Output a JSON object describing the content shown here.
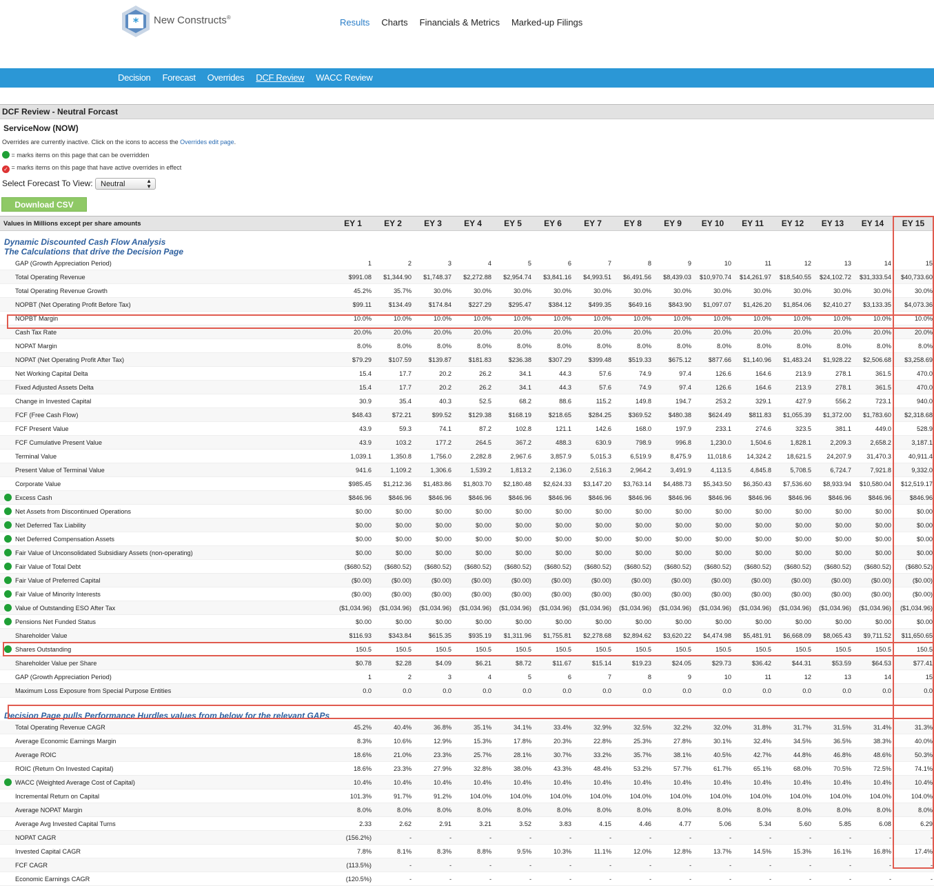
{
  "brand": {
    "name": "New Constructs",
    "reg": "®"
  },
  "top_nav": [
    "Results",
    "Charts",
    "Financials & Metrics",
    "Marked-up Filings"
  ],
  "sub_nav": [
    "Decision",
    "Forecast",
    "Overrides",
    "DCF Review",
    "WACC Review"
  ],
  "section_title": "DCF Review - Neutral Forcast",
  "company": "ServiceNow (NOW)",
  "notes": {
    "inactive_pre": "Overrides are currently inactive. Click on the icons to access the ",
    "inactive_link": "Overrides edit page",
    "inactive_post": ".",
    "green": " = marks items on this page that can be overridden",
    "red": " = marks items on this page that have active overrides in effect"
  },
  "forecast": {
    "label": "Select Forecast To View:",
    "value": "Neutral"
  },
  "download_label": "Download CSV",
  "table": {
    "header_label": "Values in Millions except per share amounts",
    "columns": [
      "EY 1",
      "EY 2",
      "EY 3",
      "EY 4",
      "EY 5",
      "EY 6",
      "EY 7",
      "EY 8",
      "EY 9",
      "EY 10",
      "EY 11",
      "EY 12",
      "EY 13",
      "EY 14",
      "EY 15"
    ],
    "section1": [
      "Dynamic Discounted Cash Flow Analysis",
      "The Calculations that drive the Decision Page"
    ],
    "rows1": [
      {
        "label": "GAP (Growth Appreciation Period)",
        "o": false,
        "v": [
          "1",
          "2",
          "3",
          "4",
          "5",
          "6",
          "7",
          "8",
          "9",
          "10",
          "11",
          "12",
          "13",
          "14",
          "15"
        ]
      },
      {
        "label": "Total Operating Revenue",
        "o": false,
        "v": [
          "$991.08",
          "$1,344.90",
          "$1,748.37",
          "$2,272.88",
          "$2,954.74",
          "$3,841.16",
          "$4,993.51",
          "$6,491.56",
          "$8,439.03",
          "$10,970.74",
          "$14,261.97",
          "$18,540.55",
          "$24,102.72",
          "$31,333.54",
          "$40,733.60"
        ]
      },
      {
        "label": "Total Operating Revenue Growth",
        "o": false,
        "v": [
          "45.2%",
          "35.7%",
          "30.0%",
          "30.0%",
          "30.0%",
          "30.0%",
          "30.0%",
          "30.0%",
          "30.0%",
          "30.0%",
          "30.0%",
          "30.0%",
          "30.0%",
          "30.0%",
          "30.0%"
        ]
      },
      {
        "label": "NOPBT (Net Operating Profit Before Tax)",
        "o": false,
        "v": [
          "$99.11",
          "$134.49",
          "$174.84",
          "$227.29",
          "$295.47",
          "$384.12",
          "$499.35",
          "$649.16",
          "$843.90",
          "$1,097.07",
          "$1,426.20",
          "$1,854.06",
          "$2,410.27",
          "$3,133.35",
          "$4,073.36"
        ]
      },
      {
        "label": "NOPBT Margin",
        "o": false,
        "v": [
          "10.0%",
          "10.0%",
          "10.0%",
          "10.0%",
          "10.0%",
          "10.0%",
          "10.0%",
          "10.0%",
          "10.0%",
          "10.0%",
          "10.0%",
          "10.0%",
          "10.0%",
          "10.0%",
          "10.0%"
        ]
      },
      {
        "label": "Cash Tax Rate",
        "o": false,
        "v": [
          "20.0%",
          "20.0%",
          "20.0%",
          "20.0%",
          "20.0%",
          "20.0%",
          "20.0%",
          "20.0%",
          "20.0%",
          "20.0%",
          "20.0%",
          "20.0%",
          "20.0%",
          "20.0%",
          "20.0%"
        ]
      },
      {
        "label": "NOPAT Margin",
        "o": false,
        "v": [
          "8.0%",
          "8.0%",
          "8.0%",
          "8.0%",
          "8.0%",
          "8.0%",
          "8.0%",
          "8.0%",
          "8.0%",
          "8.0%",
          "8.0%",
          "8.0%",
          "8.0%",
          "8.0%",
          "8.0%"
        ]
      },
      {
        "label": "NOPAT (Net Operating Profit After Tax)",
        "o": false,
        "v": [
          "$79.29",
          "$107.59",
          "$139.87",
          "$181.83",
          "$236.38",
          "$307.29",
          "$399.48",
          "$519.33",
          "$675.12",
          "$877.66",
          "$1,140.96",
          "$1,483.24",
          "$1,928.22",
          "$2,506.68",
          "$3,258.69"
        ]
      },
      {
        "label": "Net Working Capital Delta",
        "o": false,
        "v": [
          "15.4",
          "17.7",
          "20.2",
          "26.2",
          "34.1",
          "44.3",
          "57.6",
          "74.9",
          "97.4",
          "126.6",
          "164.6",
          "213.9",
          "278.1",
          "361.5",
          "470.0"
        ]
      },
      {
        "label": "Fixed Adjusted Assets Delta",
        "o": false,
        "v": [
          "15.4",
          "17.7",
          "20.2",
          "26.2",
          "34.1",
          "44.3",
          "57.6",
          "74.9",
          "97.4",
          "126.6",
          "164.6",
          "213.9",
          "278.1",
          "361.5",
          "470.0"
        ]
      },
      {
        "label": "Change in Invested Capital",
        "o": false,
        "v": [
          "30.9",
          "35.4",
          "40.3",
          "52.5",
          "68.2",
          "88.6",
          "115.2",
          "149.8",
          "194.7",
          "253.2",
          "329.1",
          "427.9",
          "556.2",
          "723.1",
          "940.0"
        ]
      },
      {
        "label": "FCF (Free Cash Flow)",
        "o": false,
        "v": [
          "$48.43",
          "$72.21",
          "$99.52",
          "$129.38",
          "$168.19",
          "$218.65",
          "$284.25",
          "$369.52",
          "$480.38",
          "$624.49",
          "$811.83",
          "$1,055.39",
          "$1,372.00",
          "$1,783.60",
          "$2,318.68"
        ]
      },
      {
        "label": "FCF Present Value",
        "o": false,
        "v": [
          "43.9",
          "59.3",
          "74.1",
          "87.2",
          "102.8",
          "121.1",
          "142.6",
          "168.0",
          "197.9",
          "233.1",
          "274.6",
          "323.5",
          "381.1",
          "449.0",
          "528.9"
        ]
      },
      {
        "label": "FCF Cumulative Present Value",
        "o": false,
        "v": [
          "43.9",
          "103.2",
          "177.2",
          "264.5",
          "367.2",
          "488.3",
          "630.9",
          "798.9",
          "996.8",
          "1,230.0",
          "1,504.6",
          "1,828.1",
          "2,209.3",
          "2,658.2",
          "3,187.1"
        ]
      },
      {
        "label": "Terminal Value",
        "o": false,
        "v": [
          "1,039.1",
          "1,350.8",
          "1,756.0",
          "2,282.8",
          "2,967.6",
          "3,857.9",
          "5,015.3",
          "6,519.9",
          "8,475.9",
          "11,018.6",
          "14,324.2",
          "18,621.5",
          "24,207.9",
          "31,470.3",
          "40,911.4"
        ]
      },
      {
        "label": "Present Value of Terminal Value",
        "o": false,
        "v": [
          "941.6",
          "1,109.2",
          "1,306.6",
          "1,539.2",
          "1,813.2",
          "2,136.0",
          "2,516.3",
          "2,964.2",
          "3,491.9",
          "4,113.5",
          "4,845.8",
          "5,708.5",
          "6,724.7",
          "7,921.8",
          "9,332.0"
        ]
      },
      {
        "label": "Corporate Value",
        "o": false,
        "v": [
          "$985.45",
          "$1,212.36",
          "$1,483.86",
          "$1,803.70",
          "$2,180.48",
          "$2,624.33",
          "$3,147.20",
          "$3,763.14",
          "$4,488.73",
          "$5,343.50",
          "$6,350.43",
          "$7,536.60",
          "$8,933.94",
          "$10,580.04",
          "$12,519.17"
        ]
      },
      {
        "label": "Excess Cash",
        "o": true,
        "v": [
          "$846.96",
          "$846.96",
          "$846.96",
          "$846.96",
          "$846.96",
          "$846.96",
          "$846.96",
          "$846.96",
          "$846.96",
          "$846.96",
          "$846.96",
          "$846.96",
          "$846.96",
          "$846.96",
          "$846.96"
        ]
      },
      {
        "label": "Net Assets from Discontinued Operations",
        "o": true,
        "v": [
          "$0.00",
          "$0.00",
          "$0.00",
          "$0.00",
          "$0.00",
          "$0.00",
          "$0.00",
          "$0.00",
          "$0.00",
          "$0.00",
          "$0.00",
          "$0.00",
          "$0.00",
          "$0.00",
          "$0.00"
        ]
      },
      {
        "label": "Net Deferred Tax Liability",
        "o": true,
        "v": [
          "$0.00",
          "$0.00",
          "$0.00",
          "$0.00",
          "$0.00",
          "$0.00",
          "$0.00",
          "$0.00",
          "$0.00",
          "$0.00",
          "$0.00",
          "$0.00",
          "$0.00",
          "$0.00",
          "$0.00"
        ]
      },
      {
        "label": "Net Deferred Compensation Assets",
        "o": true,
        "v": [
          "$0.00",
          "$0.00",
          "$0.00",
          "$0.00",
          "$0.00",
          "$0.00",
          "$0.00",
          "$0.00",
          "$0.00",
          "$0.00",
          "$0.00",
          "$0.00",
          "$0.00",
          "$0.00",
          "$0.00"
        ]
      },
      {
        "label": "Fair Value of Unconsolidated Subsidiary Assets (non-operating)",
        "o": true,
        "v": [
          "$0.00",
          "$0.00",
          "$0.00",
          "$0.00",
          "$0.00",
          "$0.00",
          "$0.00",
          "$0.00",
          "$0.00",
          "$0.00",
          "$0.00",
          "$0.00",
          "$0.00",
          "$0.00",
          "$0.00"
        ]
      },
      {
        "label": "Fair Value of Total Debt",
        "o": true,
        "v": [
          "($680.52)",
          "($680.52)",
          "($680.52)",
          "($680.52)",
          "($680.52)",
          "($680.52)",
          "($680.52)",
          "($680.52)",
          "($680.52)",
          "($680.52)",
          "($680.52)",
          "($680.52)",
          "($680.52)",
          "($680.52)",
          "($680.52)"
        ]
      },
      {
        "label": "Fair Value of Preferred Capital",
        "o": true,
        "v": [
          "($0.00)",
          "($0.00)",
          "($0.00)",
          "($0.00)",
          "($0.00)",
          "($0.00)",
          "($0.00)",
          "($0.00)",
          "($0.00)",
          "($0.00)",
          "($0.00)",
          "($0.00)",
          "($0.00)",
          "($0.00)",
          "($0.00)"
        ]
      },
      {
        "label": "Fair Value of Minority Interests",
        "o": true,
        "v": [
          "($0.00)",
          "($0.00)",
          "($0.00)",
          "($0.00)",
          "($0.00)",
          "($0.00)",
          "($0.00)",
          "($0.00)",
          "($0.00)",
          "($0.00)",
          "($0.00)",
          "($0.00)",
          "($0.00)",
          "($0.00)",
          "($0.00)"
        ]
      },
      {
        "label": "Value of Outstanding ESO After Tax",
        "o": true,
        "v": [
          "($1,034.96)",
          "($1,034.96)",
          "($1,034.96)",
          "($1,034.96)",
          "($1,034.96)",
          "($1,034.96)",
          "($1,034.96)",
          "($1,034.96)",
          "($1,034.96)",
          "($1,034.96)",
          "($1,034.96)",
          "($1,034.96)",
          "($1,034.96)",
          "($1,034.96)",
          "($1,034.96)"
        ]
      },
      {
        "label": "Pensions Net Funded Status",
        "o": true,
        "v": [
          "$0.00",
          "$0.00",
          "$0.00",
          "$0.00",
          "$0.00",
          "$0.00",
          "$0.00",
          "$0.00",
          "$0.00",
          "$0.00",
          "$0.00",
          "$0.00",
          "$0.00",
          "$0.00",
          "$0.00"
        ]
      },
      {
        "label": "Shareholder Value",
        "o": false,
        "v": [
          "$116.93",
          "$343.84",
          "$615.35",
          "$935.19",
          "$1,311.96",
          "$1,755.81",
          "$2,278.68",
          "$2,894.62",
          "$3,620.22",
          "$4,474.98",
          "$5,481.91",
          "$6,668.09",
          "$8,065.43",
          "$9,711.52",
          "$11,650.65"
        ]
      },
      {
        "label": "Shares Outstanding",
        "o": true,
        "v": [
          "150.5",
          "150.5",
          "150.5",
          "150.5",
          "150.5",
          "150.5",
          "150.5",
          "150.5",
          "150.5",
          "150.5",
          "150.5",
          "150.5",
          "150.5",
          "150.5",
          "150.5"
        ]
      },
      {
        "label": "Shareholder Value per Share",
        "o": false,
        "v": [
          "$0.78",
          "$2.28",
          "$4.09",
          "$6.21",
          "$8.72",
          "$11.67",
          "$15.14",
          "$19.23",
          "$24.05",
          "$29.73",
          "$36.42",
          "$44.31",
          "$53.59",
          "$64.53",
          "$77.41"
        ]
      },
      {
        "label": "GAP (Growth Appreciation Period)",
        "o": false,
        "v": [
          "1",
          "2",
          "3",
          "4",
          "5",
          "6",
          "7",
          "8",
          "9",
          "10",
          "11",
          "12",
          "13",
          "14",
          "15"
        ]
      },
      {
        "label": "Maximum Loss Exposure from Special Purpose Entities",
        "o": false,
        "v": [
          "0.0",
          "0.0",
          "0.0",
          "0.0",
          "0.0",
          "0.0",
          "0.0",
          "0.0",
          "0.0",
          "0.0",
          "0.0",
          "0.0",
          "0.0",
          "0.0",
          "0.0"
        ]
      }
    ],
    "section2": [
      "Decision Page pulls Performance Hurdles values from below for the relevant GAPs"
    ],
    "rows2": [
      {
        "label": "Total Operating Revenue CAGR",
        "o": false,
        "v": [
          "45.2%",
          "40.4%",
          "36.8%",
          "35.1%",
          "34.1%",
          "33.4%",
          "32.9%",
          "32.5%",
          "32.2%",
          "32.0%",
          "31.8%",
          "31.7%",
          "31.5%",
          "31.4%",
          "31.3%"
        ]
      },
      {
        "label": "Average Economic Earnings Margin",
        "o": false,
        "v": [
          "8.3%",
          "10.6%",
          "12.9%",
          "15.3%",
          "17.8%",
          "20.3%",
          "22.8%",
          "25.3%",
          "27.8%",
          "30.1%",
          "32.4%",
          "34.5%",
          "36.5%",
          "38.3%",
          "40.0%"
        ]
      },
      {
        "label": "Average ROIC",
        "o": false,
        "v": [
          "18.6%",
          "21.0%",
          "23.3%",
          "25.7%",
          "28.1%",
          "30.7%",
          "33.2%",
          "35.7%",
          "38.1%",
          "40.5%",
          "42.7%",
          "44.8%",
          "46.8%",
          "48.6%",
          "50.3%"
        ]
      },
      {
        "label": "ROIC (Return On Invested Capital)",
        "o": false,
        "v": [
          "18.6%",
          "23.3%",
          "27.9%",
          "32.8%",
          "38.0%",
          "43.3%",
          "48.4%",
          "53.2%",
          "57.7%",
          "61.7%",
          "65.1%",
          "68.0%",
          "70.5%",
          "72.5%",
          "74.1%"
        ]
      },
      {
        "label": "WACC (Weighted Average Cost of Capital)",
        "o": true,
        "v": [
          "10.4%",
          "10.4%",
          "10.4%",
          "10.4%",
          "10.4%",
          "10.4%",
          "10.4%",
          "10.4%",
          "10.4%",
          "10.4%",
          "10.4%",
          "10.4%",
          "10.4%",
          "10.4%",
          "10.4%"
        ]
      },
      {
        "label": "Incremental Return on Capital",
        "o": false,
        "v": [
          "101.3%",
          "91.7%",
          "91.2%",
          "104.0%",
          "104.0%",
          "104.0%",
          "104.0%",
          "104.0%",
          "104.0%",
          "104.0%",
          "104.0%",
          "104.0%",
          "104.0%",
          "104.0%",
          "104.0%"
        ]
      },
      {
        "label": "Average NOPAT Margin",
        "o": false,
        "v": [
          "8.0%",
          "8.0%",
          "8.0%",
          "8.0%",
          "8.0%",
          "8.0%",
          "8.0%",
          "8.0%",
          "8.0%",
          "8.0%",
          "8.0%",
          "8.0%",
          "8.0%",
          "8.0%",
          "8.0%"
        ]
      },
      {
        "label": "Average Avg Invested Capital Turns",
        "o": false,
        "v": [
          "2.33",
          "2.62",
          "2.91",
          "3.21",
          "3.52",
          "3.83",
          "4.15",
          "4.46",
          "4.77",
          "5.06",
          "5.34",
          "5.60",
          "5.85",
          "6.08",
          "6.29"
        ]
      },
      {
        "label": "NOPAT CAGR",
        "o": false,
        "v": [
          "(156.2%)",
          "-",
          "-",
          "-",
          "-",
          "-",
          "-",
          "-",
          "-",
          "-",
          "-",
          "-",
          "-",
          "-",
          "-"
        ]
      },
      {
        "label": "Invested Capital CAGR",
        "o": false,
        "v": [
          "7.8%",
          "8.1%",
          "8.3%",
          "8.8%",
          "9.5%",
          "10.3%",
          "11.1%",
          "12.0%",
          "12.8%",
          "13.7%",
          "14.5%",
          "15.3%",
          "16.1%",
          "16.8%",
          "17.4%"
        ]
      },
      {
        "label": "FCF CAGR",
        "o": false,
        "v": [
          "(113.5%)",
          "-",
          "-",
          "-",
          "-",
          "-",
          "-",
          "-",
          "-",
          "-",
          "-",
          "-",
          "-",
          "-",
          "-"
        ]
      },
      {
        "label": "Economic Earnings CAGR",
        "o": false,
        "v": [
          "(120.5%)",
          "-",
          "-",
          "-",
          "-",
          "-",
          "-",
          "-",
          "-",
          "-",
          "-",
          "-",
          "-",
          "-",
          "-"
        ]
      }
    ]
  },
  "colors": {
    "nav_blue": "#2b97d6",
    "override_green": "#1fa036",
    "highlight_red": "#e05a4e",
    "download_green": "#8fc966"
  }
}
